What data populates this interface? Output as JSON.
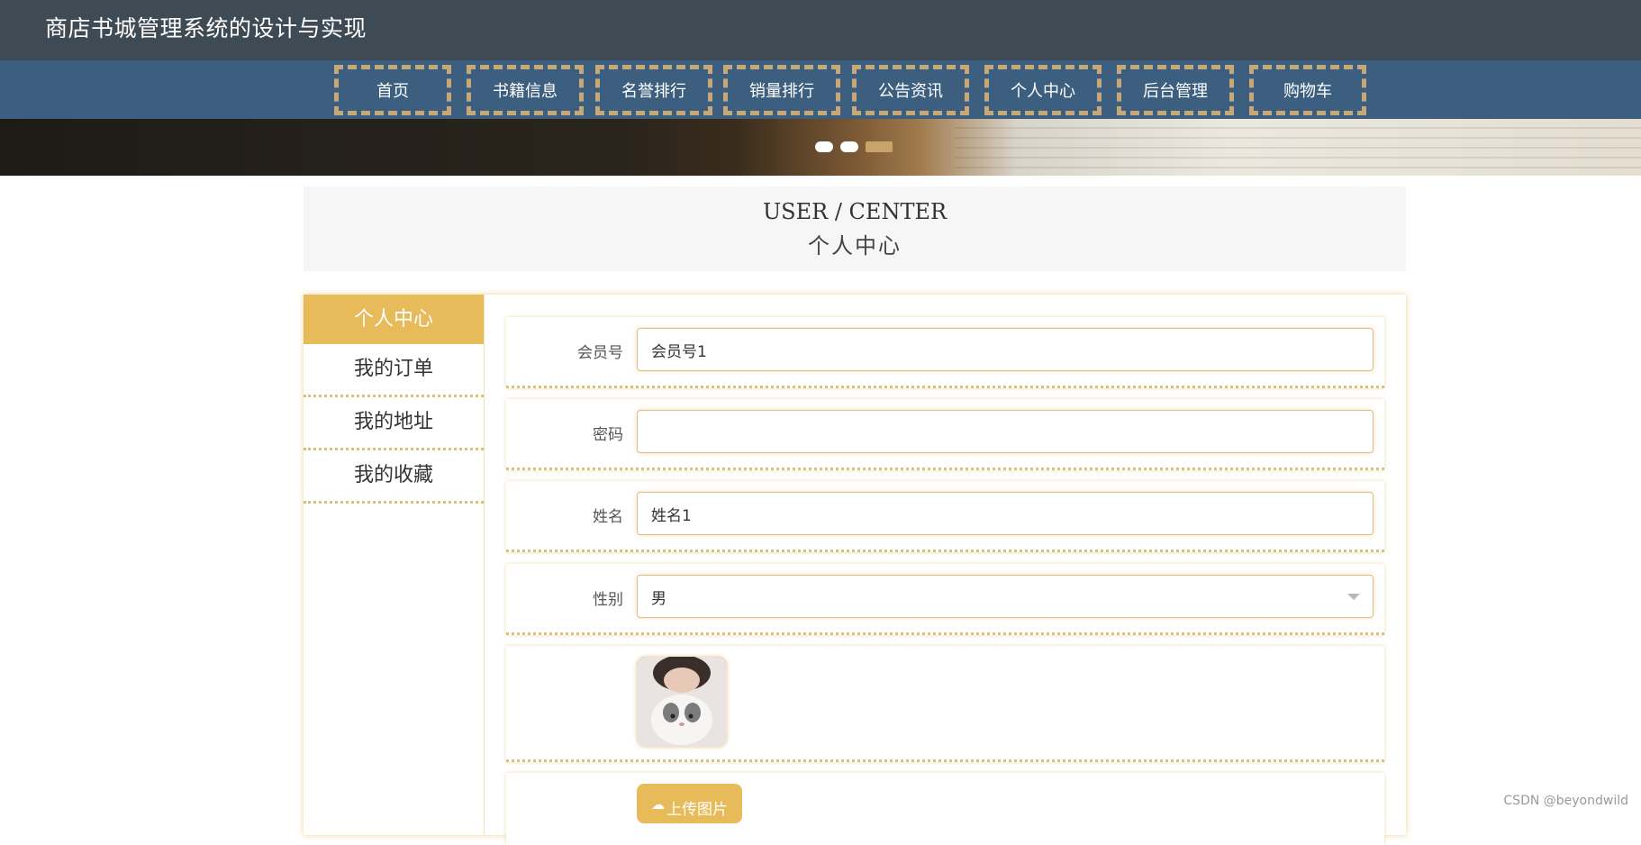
{
  "header": {
    "title": "商店书城管理系统的设计与实现"
  },
  "nav": {
    "items": [
      "首页",
      "书籍信息",
      "名誉排行",
      "销量排行",
      "公告资讯",
      "个人中心",
      "后台管理",
      "购物车"
    ]
  },
  "banner": {
    "dots": 3,
    "active_dot": 3
  },
  "section": {
    "en_title": "USER / CENTER",
    "cn_title": "个人中心"
  },
  "sidebar": {
    "items": [
      "个人中心",
      "我的订单",
      "我的地址",
      "我的收藏"
    ],
    "active": "个人中心"
  },
  "form": {
    "member_no": {
      "label": "会员号",
      "value": "会员号1"
    },
    "password": {
      "label": "密码",
      "value": ""
    },
    "name": {
      "label": "姓名",
      "value": "姓名1"
    },
    "gender": {
      "label": "性别",
      "value": "男"
    },
    "upload_label": "上传图片"
  },
  "watermark": "CSDN @beyondwild",
  "colors": {
    "accent": "#e8bb5a",
    "nav_bg": "#3c5f7f",
    "header_bg": "#3f4b54"
  }
}
